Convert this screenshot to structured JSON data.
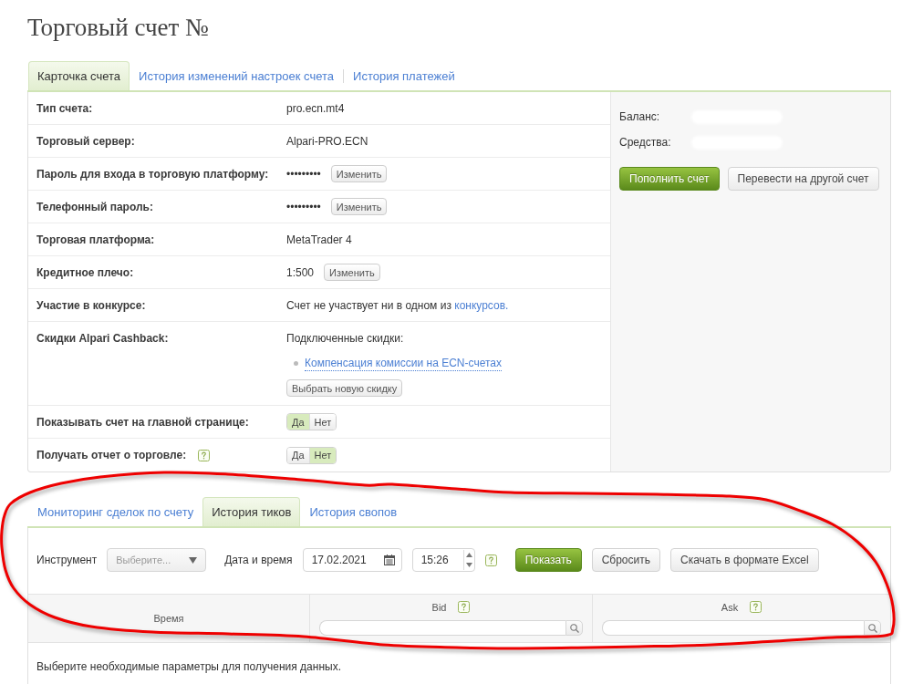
{
  "page": {
    "title": "Торговый счет №"
  },
  "account_tabs": [
    {
      "label": "Карточка счета",
      "selected": true
    },
    {
      "label": "История изменений настроек счета",
      "selected": false
    },
    {
      "label": "История платежей",
      "selected": false
    }
  ],
  "account_details": [
    {
      "kind": "text",
      "label": "Тип счета:",
      "help": false,
      "value": "pro.ecn.mt4"
    },
    {
      "kind": "text",
      "label": "Торговый сервер:",
      "help": false,
      "value": "Alpari-PRO.ECN"
    },
    {
      "kind": "action",
      "label": "Пароль для входа в торговую платформу:",
      "help": false,
      "value": "•••••••••",
      "button": "Изменить"
    },
    {
      "kind": "action",
      "label": "Телефонный пароль:",
      "help": false,
      "value": "•••••••••",
      "button": "Изменить"
    },
    {
      "kind": "text",
      "label": "Торговая платформа:",
      "help": false,
      "value": "MetaTrader 4"
    },
    {
      "kind": "action",
      "label": "Кредитное плечо:",
      "help": false,
      "value": "1:500",
      "button": "Изменить"
    },
    {
      "kind": "link_text",
      "label": "Участие в конкурсе:",
      "help": false,
      "value": "Счет не участвует ни в одном из ",
      "link": "конкурсов."
    },
    {
      "kind": "discounts",
      "label": "Скидки Alpari Cashback:",
      "help": false,
      "heading": "Подключенные скидки:",
      "items": [
        "Компенсация комиссии на ECN-счетах"
      ],
      "button": "Выбрать новую скидку"
    },
    {
      "kind": "toggle",
      "label": "Показывать счет на главной странице:",
      "help": false,
      "options": [
        {
          "label": "Да",
          "selected": true
        },
        {
          "label": "Нет",
          "selected": false
        }
      ]
    },
    {
      "kind": "toggle",
      "label": "Получать отчет о торговле:",
      "help": true,
      "options": [
        {
          "label": "Да",
          "selected": false
        },
        {
          "label": "Нет",
          "selected": true
        }
      ]
    }
  ],
  "balance_panel": {
    "fields": [
      {
        "label": "Баланс:",
        "redacted": true
      },
      {
        "label": "Средства:",
        "redacted": true
      }
    ],
    "buttons": [
      {
        "label": "Пополнить счет",
        "kind": "primary"
      },
      {
        "label": "Перевести на другой счет",
        "kind": "secondary"
      }
    ]
  },
  "history_tabs": [
    {
      "label": "Мониторинг сделок по счету",
      "selected": false
    },
    {
      "label": "История тиков",
      "selected": true
    },
    {
      "label": "История свопов",
      "selected": false
    }
  ],
  "tick_filters": {
    "instrument": {
      "label": "Инструмент",
      "placeholder": "Выберите..."
    },
    "datetime": {
      "label": "Дата и время",
      "date": "17.02.2021",
      "time": "15:26",
      "help": true
    },
    "buttons": [
      {
        "label": "Показать",
        "kind": "primary"
      },
      {
        "label": "Сбросить",
        "kind": "secondary"
      },
      {
        "label": "Скачать в формате Excel",
        "kind": "secondary"
      }
    ]
  },
  "ticks_table": {
    "columns": [
      {
        "label": "Время",
        "help": false,
        "filter": false
      },
      {
        "label": "Bid",
        "help": true,
        "filter": true
      },
      {
        "label": "Ask",
        "help": true,
        "filter": true
      }
    ],
    "empty_message": "Выберите необходимые параметры для получения данных."
  }
}
